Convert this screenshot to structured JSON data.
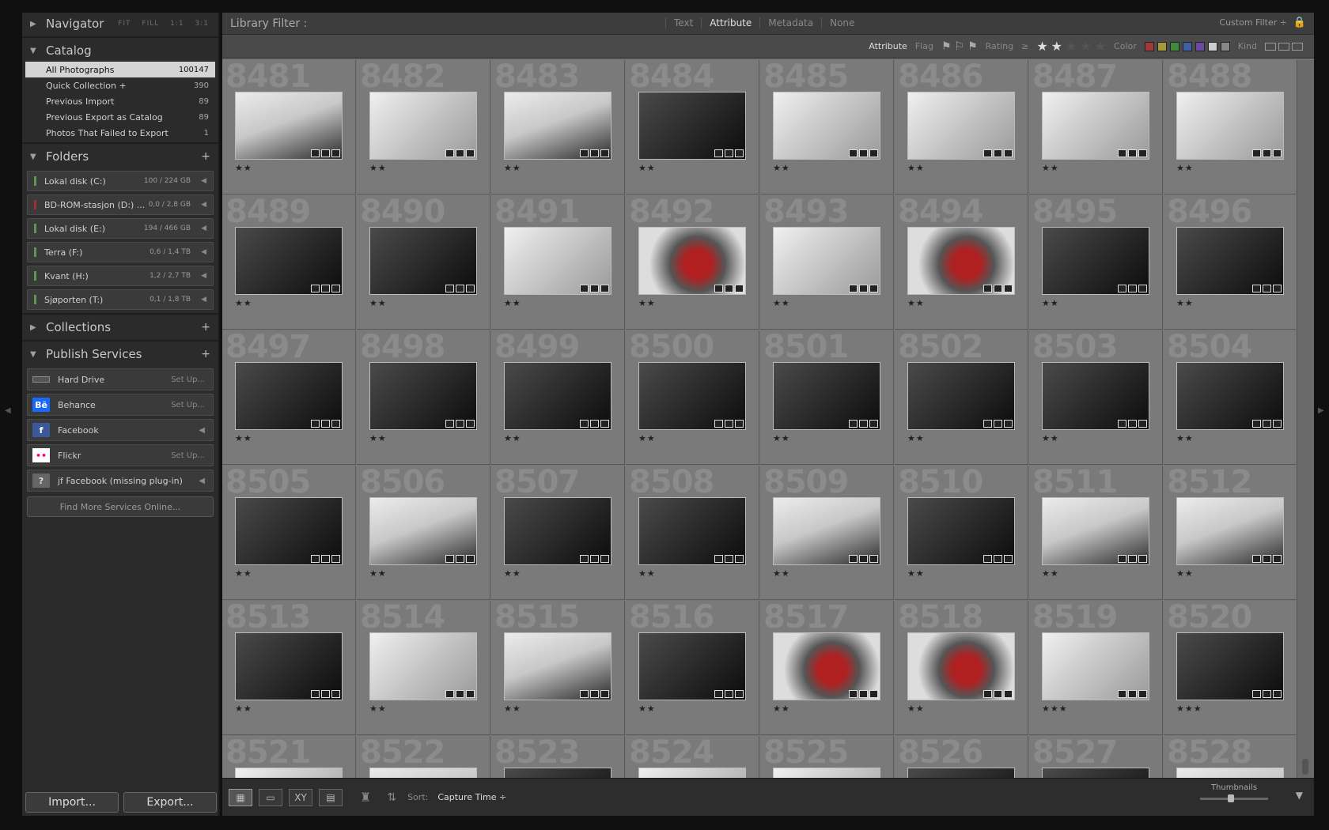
{
  "navigator": {
    "title": "Navigator",
    "options": [
      "FIT",
      "FILL",
      "1:1",
      "3:1"
    ]
  },
  "catalog": {
    "title": "Catalog",
    "items": [
      {
        "label": "All Photographs",
        "count": "100147"
      },
      {
        "label": "Quick Collection  +",
        "count": "390"
      },
      {
        "label": "Previous Import",
        "count": "89"
      },
      {
        "label": "Previous Export as Catalog",
        "count": "89"
      },
      {
        "label": "Photos That Failed to Export",
        "count": "1"
      }
    ]
  },
  "folders": {
    "title": "Folders",
    "add": "+",
    "items": [
      {
        "label": "Lokal disk (C:)",
        "size": "100 / 224 GB"
      },
      {
        "label": "BD-ROM-stasjon (D:) ...",
        "size": "0,0 / 2,8 GB"
      },
      {
        "label": "Lokal disk (E:)",
        "size": "194 / 466 GB"
      },
      {
        "label": "Terra (F:)",
        "size": "0,6 / 1,4 TB"
      },
      {
        "label": "Kvant (H:)",
        "size": "1,2 / 2,7 TB"
      },
      {
        "label": "Sjøporten (T:)",
        "size": "0,1 / 1,8 TB"
      }
    ]
  },
  "collections": {
    "title": "Collections",
    "add": "+"
  },
  "publish": {
    "title": "Publish Services",
    "add": "+",
    "items": [
      {
        "label": "Hard Drive",
        "action": "Set Up..."
      },
      {
        "label": "Behance",
        "action": "Set Up...",
        "icon_text": "Bē"
      },
      {
        "label": "Facebook",
        "action": "",
        "icon_text": "f"
      },
      {
        "label": "Flickr",
        "action": "Set Up...",
        "icon_text": "••"
      },
      {
        "label": "jf Facebook (missing plug-in)",
        "action": "",
        "icon_text": "?"
      }
    ],
    "find_more": "Find More Services Online..."
  },
  "buttons": {
    "import": "Import...",
    "export": "Export..."
  },
  "filter": {
    "title": "Library Filter :",
    "tabs": [
      "Text",
      "Attribute",
      "Metadata",
      "None"
    ],
    "active_tab": "Attribute",
    "custom": "Custom Filter ÷",
    "attr_label": "Attribute",
    "flag_label": "Flag",
    "rating_label": "Rating",
    "rating_op": "≥",
    "rating_value": 2,
    "color_label": "Color",
    "kind_label": "Kind",
    "colors": [
      "#a03a3a",
      "#a39a3a",
      "#3f8a3f",
      "#3f5fa0",
      "#6a4aa0",
      "#cccccc",
      "#888888"
    ]
  },
  "grid": {
    "cells": [
      {
        "num": "8481",
        "stars": "★★",
        "tone": "mixed"
      },
      {
        "num": "8482",
        "stars": "★★",
        "tone": "white"
      },
      {
        "num": "8483",
        "stars": "★★",
        "tone": "mixed"
      },
      {
        "num": "8484",
        "stars": "★★",
        "tone": "dark"
      },
      {
        "num": "8485",
        "stars": "★★",
        "tone": "white"
      },
      {
        "num": "8486",
        "stars": "★★",
        "tone": "white"
      },
      {
        "num": "8487",
        "stars": "★★",
        "tone": "white"
      },
      {
        "num": "8488",
        "stars": "★★",
        "tone": "white"
      },
      {
        "num": "8489",
        "stars": "★★",
        "tone": "dark"
      },
      {
        "num": "8490",
        "stars": "★★",
        "tone": "dark"
      },
      {
        "num": "8491",
        "stars": "★★",
        "tone": "white"
      },
      {
        "num": "8492",
        "stars": "★★",
        "tone": "red"
      },
      {
        "num": "8493",
        "stars": "★★",
        "tone": "white"
      },
      {
        "num": "8494",
        "stars": "★★",
        "tone": "red"
      },
      {
        "num": "8495",
        "stars": "★★",
        "tone": "dark"
      },
      {
        "num": "8496",
        "stars": "★★",
        "tone": "dark"
      },
      {
        "num": "8497",
        "stars": "★★",
        "tone": "dark"
      },
      {
        "num": "8498",
        "stars": "★★",
        "tone": "dark"
      },
      {
        "num": "8499",
        "stars": "★★",
        "tone": "dark"
      },
      {
        "num": "8500",
        "stars": "★★",
        "tone": "dark"
      },
      {
        "num": "8501",
        "stars": "★★",
        "tone": "dark"
      },
      {
        "num": "8502",
        "stars": "★★",
        "tone": "dark"
      },
      {
        "num": "8503",
        "stars": "★★",
        "tone": "dark"
      },
      {
        "num": "8504",
        "stars": "★★",
        "tone": "dark"
      },
      {
        "num": "8505",
        "stars": "★★",
        "tone": "dark"
      },
      {
        "num": "8506",
        "stars": "★★",
        "tone": "mixed"
      },
      {
        "num": "8507",
        "stars": "★★",
        "tone": "dark"
      },
      {
        "num": "8508",
        "stars": "★★",
        "tone": "dark"
      },
      {
        "num": "8509",
        "stars": "★★",
        "tone": "mixed"
      },
      {
        "num": "8510",
        "stars": "★★",
        "tone": "dark"
      },
      {
        "num": "8511",
        "stars": "★★",
        "tone": "mixed"
      },
      {
        "num": "8512",
        "stars": "★★",
        "tone": "mixed"
      },
      {
        "num": "8513",
        "stars": "★★",
        "tone": "dark"
      },
      {
        "num": "8514",
        "stars": "★★",
        "tone": "white"
      },
      {
        "num": "8515",
        "stars": "★★",
        "tone": "mixed"
      },
      {
        "num": "8516",
        "stars": "★★",
        "tone": "dark"
      },
      {
        "num": "8517",
        "stars": "★★",
        "tone": "red"
      },
      {
        "num": "8518",
        "stars": "★★",
        "tone": "red"
      },
      {
        "num": "8519",
        "stars": "★★★",
        "tone": "white"
      },
      {
        "num": "8520",
        "stars": "★★★",
        "tone": "dark"
      },
      {
        "num": "8521",
        "stars": "",
        "tone": "white"
      },
      {
        "num": "8522",
        "stars": "",
        "tone": "mixed"
      },
      {
        "num": "8523",
        "stars": "",
        "tone": "dark"
      },
      {
        "num": "8524",
        "stars": "",
        "tone": "white"
      },
      {
        "num": "8525",
        "stars": "",
        "tone": "white"
      },
      {
        "num": "8526",
        "stars": "",
        "tone": "dark"
      },
      {
        "num": "8527",
        "stars": "",
        "tone": "dark"
      },
      {
        "num": "8528",
        "stars": "",
        "tone": "mixed"
      }
    ]
  },
  "toolbar": {
    "sort_label": "Sort:",
    "sort_value": "Capture Time ÷",
    "thumbnails_label": "Thumbnails",
    "thumbnail_size": 0.45
  }
}
